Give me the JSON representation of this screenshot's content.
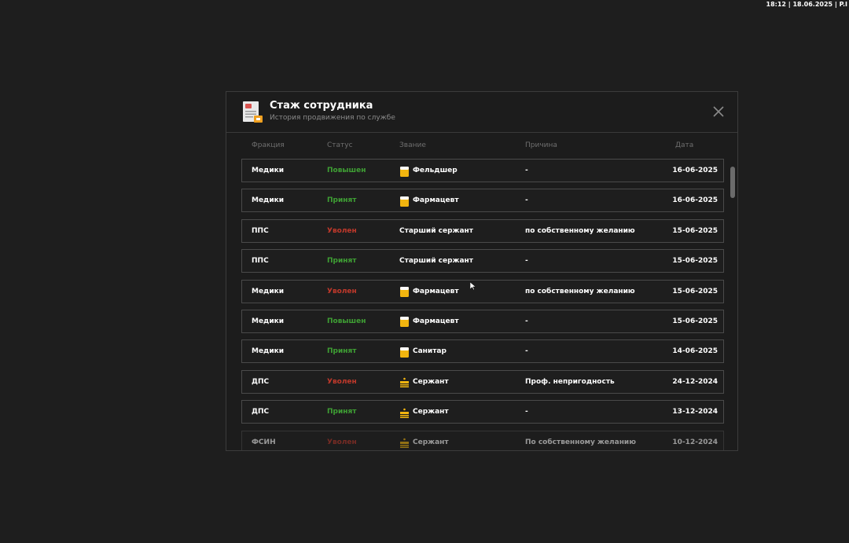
{
  "clock": "18:12 | 18.06.2025 | P.I",
  "modal": {
    "title": "Стаж сотрудника",
    "subtitle": "История продвижения по службе"
  },
  "columns": {
    "fraction": "Фракция",
    "status": "Статус",
    "rank": "Звание",
    "reason": "Причина",
    "date": "Дата"
  },
  "colors": {
    "promoted": "#3fa034",
    "accepted": "#3fa034",
    "fired": "#c0392b",
    "rank_badge": "#f2b50f"
  },
  "rows": [
    {
      "fraction": "Медики",
      "status": "Повышен",
      "status_type": "promoted",
      "rank": "Фельдшер",
      "rank_icon": "medic-rank-icon",
      "reason": "-",
      "date": "16-06-2025"
    },
    {
      "fraction": "Медики",
      "status": "Принят",
      "status_type": "accepted",
      "rank": "Фармацевт",
      "rank_icon": "medic-rank-icon",
      "reason": "-",
      "date": "16-06-2025"
    },
    {
      "fraction": "ППС",
      "status": "Уволен",
      "status_type": "fired",
      "rank": "Старший сержант",
      "rank_icon": "",
      "reason": "по собственному желанию",
      "date": "15-06-2025"
    },
    {
      "fraction": "ППС",
      "status": "Принят",
      "status_type": "accepted",
      "rank": "Старший сержант",
      "rank_icon": "",
      "reason": "-",
      "date": "15-06-2025"
    },
    {
      "fraction": "Медики",
      "status": "Уволен",
      "status_type": "fired",
      "rank": "Фармацевт",
      "rank_icon": "medic-rank-icon",
      "reason": "по собственному желанию",
      "date": "15-06-2025"
    },
    {
      "fraction": "Медики",
      "status": "Повышен",
      "status_type": "promoted",
      "rank": "Фармацевт",
      "rank_icon": "medic-rank-icon",
      "reason": "-",
      "date": "15-06-2025"
    },
    {
      "fraction": "Медики",
      "status": "Принят",
      "status_type": "accepted",
      "rank": "Санитар",
      "rank_icon": "medic-rank-icon",
      "reason": "-",
      "date": "14-06-2025"
    },
    {
      "fraction": "ДПС",
      "status": "Уволен",
      "status_type": "fired",
      "rank": "Сержант",
      "rank_icon": "sergeant-rank-icon",
      "reason": "Проф. непригодность",
      "date": "24-12-2024"
    },
    {
      "fraction": "ДПС",
      "status": "Принят",
      "status_type": "accepted",
      "rank": "Сержант",
      "rank_icon": "sergeant-rank-icon",
      "reason": "-",
      "date": "13-12-2024"
    },
    {
      "fraction": "ФСИН",
      "status": "Уволен",
      "status_type": "fired",
      "rank": "Сержант",
      "rank_icon": "sergeant-rank-icon",
      "reason": "По собственному желанию",
      "date": "10-12-2024"
    }
  ]
}
